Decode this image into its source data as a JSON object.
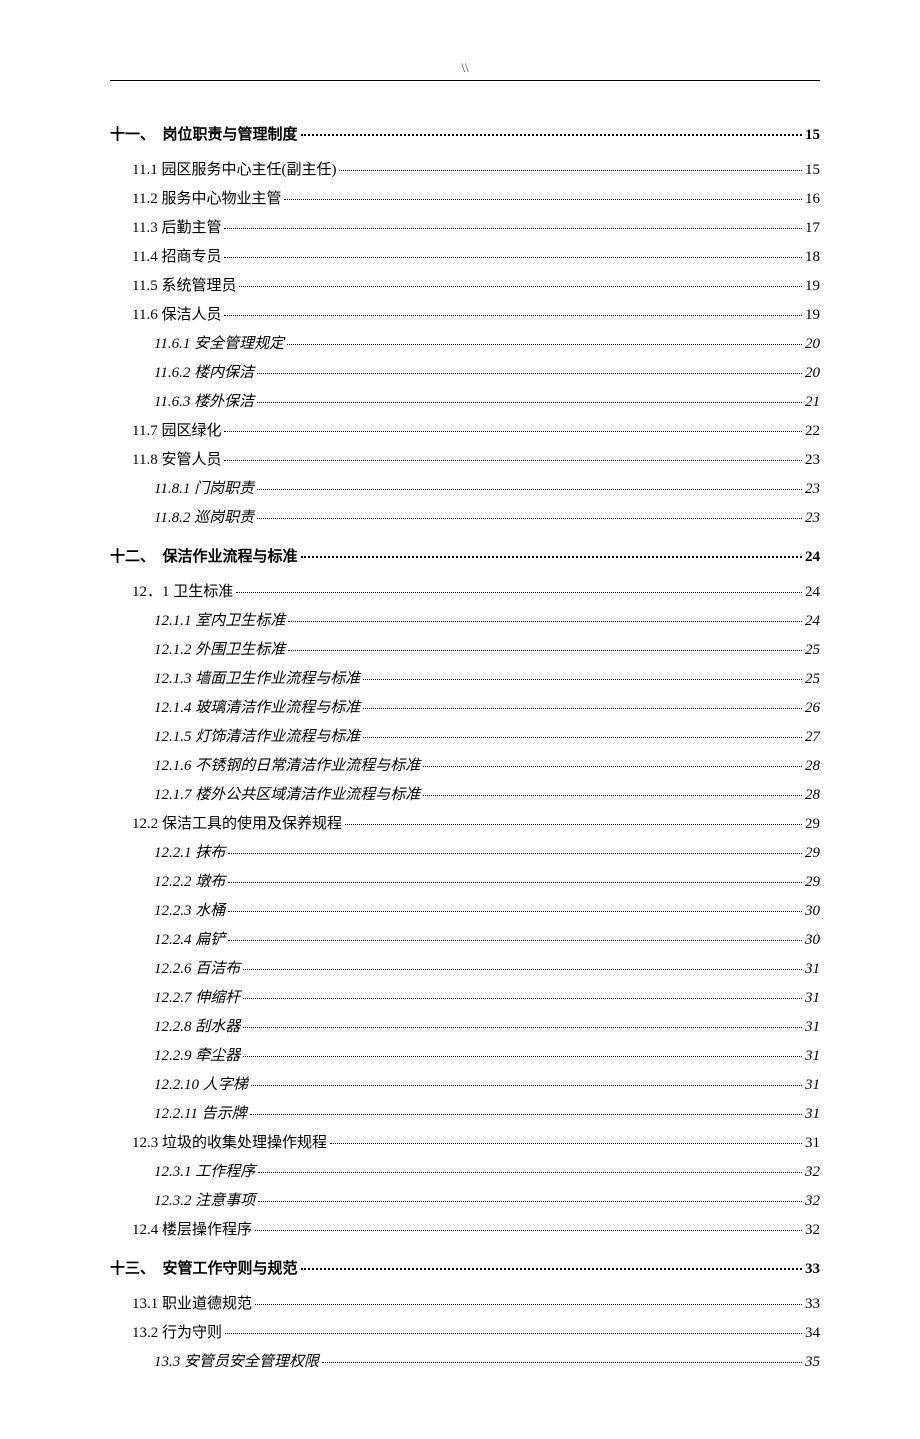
{
  "header_mark": "\\\\",
  "toc": [
    {
      "level": 1,
      "label": "十一、　岗位职责与管理制度",
      "page": "15"
    },
    {
      "level": 2,
      "label": "11.1 园区服务中心主任(副主任)",
      "page": "15"
    },
    {
      "level": 2,
      "label": "11.2 服务中心物业主管",
      "page": "16"
    },
    {
      "level": 2,
      "label": "11.3 后勤主管",
      "page": "17"
    },
    {
      "level": 2,
      "label": "11.4 招商专员",
      "page": "18"
    },
    {
      "level": 2,
      "label": "11.5 系统管理员",
      "page": "19"
    },
    {
      "level": 2,
      "label": "11.6 保洁人员",
      "page": "19"
    },
    {
      "level": 3,
      "label": "11.6.1 安全管理规定",
      "page": "20"
    },
    {
      "level": 3,
      "label": "11.6.2 楼内保洁",
      "page": "20"
    },
    {
      "level": 3,
      "label": "11.6.3 楼外保洁",
      "page": "21"
    },
    {
      "level": 2,
      "label": "11.7 园区绿化",
      "page": "22"
    },
    {
      "level": 2,
      "label": "11.8 安管人员",
      "page": "23"
    },
    {
      "level": 3,
      "label": "11.8.1 门岗职责",
      "page": "23"
    },
    {
      "level": 3,
      "label": "11.8.2 巡岗职责",
      "page": "23"
    },
    {
      "level": 1,
      "label": "十二、　保洁作业流程与标准",
      "page": "24"
    },
    {
      "level": 2,
      "label": "12．1 卫生标准",
      "page": "24"
    },
    {
      "level": 3,
      "label": "12.1.1 室内卫生标准",
      "page": "24"
    },
    {
      "level": 3,
      "label": "12.1.2 外围卫生标准",
      "page": "25"
    },
    {
      "level": 3,
      "label": "12.1.3 墙面卫生作业流程与标准",
      "page": "25"
    },
    {
      "level": 3,
      "label": "12.1.4 玻璃清洁作业流程与标准",
      "page": "26"
    },
    {
      "level": 3,
      "label": "12.1.5 灯饰清洁作业流程与标准",
      "page": "27"
    },
    {
      "level": 3,
      "label": "12.1.6 不锈钢的日常清洁作业流程与标准",
      "page": "28"
    },
    {
      "level": 3,
      "label": "12.1.7 楼外公共区域清洁作业流程与标准",
      "page": "28"
    },
    {
      "level": 2,
      "label": "12.2 保洁工具的使用及保养规程",
      "page": "29"
    },
    {
      "level": 3,
      "label": "12.2.1 抹布",
      "page": "29"
    },
    {
      "level": 3,
      "label": "12.2.2 墩布",
      "page": "29"
    },
    {
      "level": 3,
      "label": "12.2.3 水桶",
      "page": "30"
    },
    {
      "level": 3,
      "label": "12.2.4 扁铲",
      "page": "30"
    },
    {
      "level": 3,
      "label": "12.2.6 百洁布",
      "page": "31"
    },
    {
      "level": 3,
      "label": "12.2.7 伸缩杆",
      "page": "31"
    },
    {
      "level": 3,
      "label": "12.2.8 刮水器",
      "page": "31"
    },
    {
      "level": 3,
      "label": "12.2.9 牵尘器",
      "page": "31"
    },
    {
      "level": 3,
      "label": "12.2.10 人字梯",
      "page": "31"
    },
    {
      "level": 3,
      "label": "12.2.11 告示牌",
      "page": "31"
    },
    {
      "level": 2,
      "label": "12.3 垃圾的收集处理操作规程",
      "page": "31"
    },
    {
      "level": 3,
      "label": "12.3.1 工作程序",
      "page": "32"
    },
    {
      "level": 3,
      "label": "12.3.2 注意事项",
      "page": "32"
    },
    {
      "level": 2,
      "label": "12.4 楼层操作程序",
      "page": "32"
    },
    {
      "level": 1,
      "label": "十三、　安管工作守则与规范",
      "page": "33"
    },
    {
      "level": 2,
      "label": "13.1 职业道德规范",
      "page": "33"
    },
    {
      "level": 2,
      "label": "13.2 行为守则",
      "page": "34"
    },
    {
      "level": 3,
      "label": "13.3 安管员安全管理权限",
      "page": "35"
    }
  ]
}
